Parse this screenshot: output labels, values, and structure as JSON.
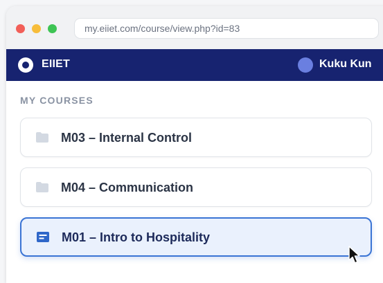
{
  "browser": {
    "url": "my.eiiet.com/course/view.php?id=83"
  },
  "navbar": {
    "brand": "EIIET",
    "user_name": "Kuku Kun"
  },
  "courses": {
    "section_label": "MY COURSES",
    "items": [
      {
        "label": "M03 – Internal Control",
        "icon": "folder-icon",
        "active": false
      },
      {
        "label": "M04 – Communication",
        "icon": "folder-icon",
        "active": false
      },
      {
        "label": "M01 – Intro to Hospitality",
        "icon": "document-icon",
        "active": true
      }
    ]
  },
  "colors": {
    "navbar": "#172370",
    "active_border": "#3a74d4",
    "active_bg": "#eaf1fd"
  }
}
